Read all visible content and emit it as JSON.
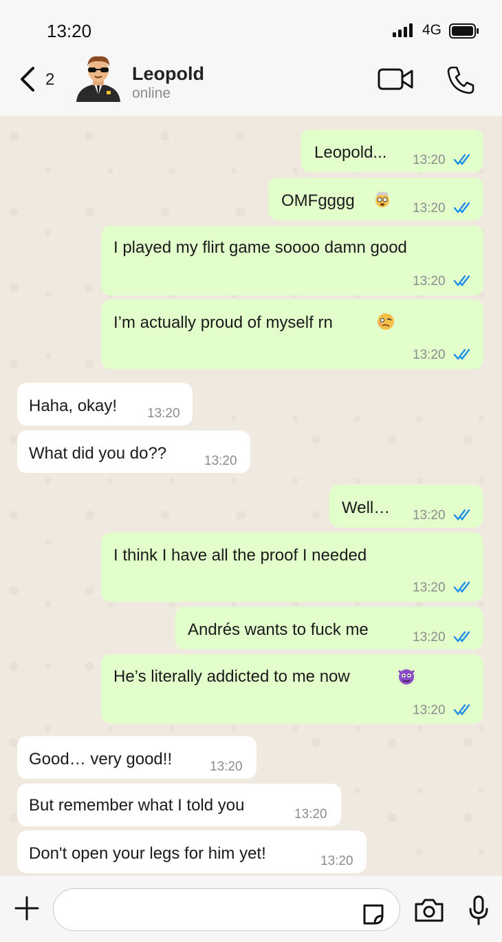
{
  "status_bar": {
    "time": "13:20",
    "network": "4G"
  },
  "header": {
    "back_count": "2",
    "contact_name": "Leopold",
    "contact_status": "online"
  },
  "messages": [
    {
      "dir": "out",
      "text": "Leopold...",
      "time": "13:20"
    },
    {
      "dir": "out",
      "text": "OMFgggg",
      "emoji": "exploding-head-emoji",
      "time": "13:20"
    },
    {
      "dir": "out",
      "text": "I played my flirt game soooo damn good",
      "time": "13:20"
    },
    {
      "dir": "out",
      "text": "I’m actually proud of myself rn",
      "emoji": "woozy-face-emoji",
      "time": "13:20"
    },
    {
      "dir": "in",
      "text": "Haha, okay!",
      "time": "13:20"
    },
    {
      "dir": "in",
      "text": "What did you do??",
      "time": "13:20"
    },
    {
      "dir": "out",
      "text": "Well…",
      "time": "13:20"
    },
    {
      "dir": "out",
      "text": "I think I have all the proof I needed",
      "time": "13:20"
    },
    {
      "dir": "out",
      "text": "Andrés wants to fuck me",
      "time": "13:20"
    },
    {
      "dir": "out",
      "text": "He’s literally addicted to me now",
      "emoji": "smiling-imp-emoji",
      "time": "13:20"
    },
    {
      "dir": "in",
      "text": "Good… very good!!",
      "time": "13:20"
    },
    {
      "dir": "in",
      "text": "But remember what I told you",
      "time": "13:20"
    },
    {
      "dir": "in",
      "text": "Don't open your legs for him yet!",
      "time": "13:20"
    }
  ],
  "colors": {
    "outgoing_bubble": "#e1fecb",
    "incoming_bubble": "#ffffff",
    "read_ticks": "#1e8fe8",
    "chat_bg": "#efe9e0"
  },
  "icons": [
    "back-chevron-icon",
    "avatar",
    "video-call-icon",
    "phone-icon",
    "plus-icon",
    "sticker-icon",
    "camera-icon",
    "mic-icon"
  ]
}
